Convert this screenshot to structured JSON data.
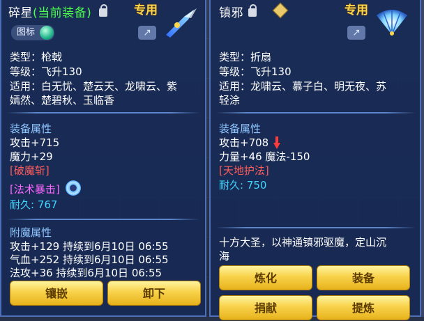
{
  "left_item": {
    "name": "碎星",
    "status": "(当前装备)",
    "special": "专用",
    "badge_label": "图标",
    "type": "类型：枪戟",
    "level": "等级：飞升130",
    "suitable_line1": "适用：白无忧、楚云天、龙啸云、紫",
    "suitable_line2": "嫣然、楚碧秋、玉临香",
    "attr_header": "装备属性",
    "attack": "攻击+715",
    "magic": "魔力+29",
    "skill1": "[破魔斩]",
    "skill2": "[法术暴击]",
    "durability_label": "耐久:",
    "durability_value": "767",
    "enchant_header": "附魔属性",
    "enchant1": "攻击+129 持续到6月10日 06:55",
    "enchant2": "气血+252 持续到6月10日 06:55",
    "enchant3": "法攻+36 持续到6月10日 06:55",
    "btn_inlay": "镶嵌",
    "btn_unequip": "卸下"
  },
  "right_item": {
    "name": "镇邪",
    "special": "专用",
    "type": "类型：折扇",
    "level": "等级：飞升130",
    "suitable_line1": "适用：龙啸云、慕子白、明无夜、苏",
    "suitable_line2": "轻涂",
    "attr_header": "装备属性",
    "attack": "攻击+708",
    "strength_magic": "力量+46 魔法-150",
    "skill1": "[天地护法]",
    "durability_label": "耐久:",
    "durability_value": "750",
    "description_line1": "十方大圣，以神通镇邪驱魔，定山沉",
    "description_line2": "海",
    "btn_refine": "炼化",
    "btn_equip": "装备",
    "btn_donate": "捐献",
    "btn_extract": "提炼"
  },
  "colors": {
    "panel_bg": "#162a56",
    "title_current": "#4dff4d",
    "special": "#ffd84a",
    "section": "#8fc6ff",
    "skill_red": "#ff5c5c",
    "skill_pink": "#ff66ff",
    "durability": "#3fd7ff",
    "button": "#f8d24a"
  },
  "icons": {
    "lock": "lock-icon",
    "share": "share-icon",
    "weapon_left": "spear-icon",
    "weapon_right": "fan-icon",
    "gem": "gem-icon",
    "decrease": "red-down-arrow-icon",
    "crit_orb": "swirl-orb-icon",
    "appraise": "diamond-badge-icon"
  }
}
